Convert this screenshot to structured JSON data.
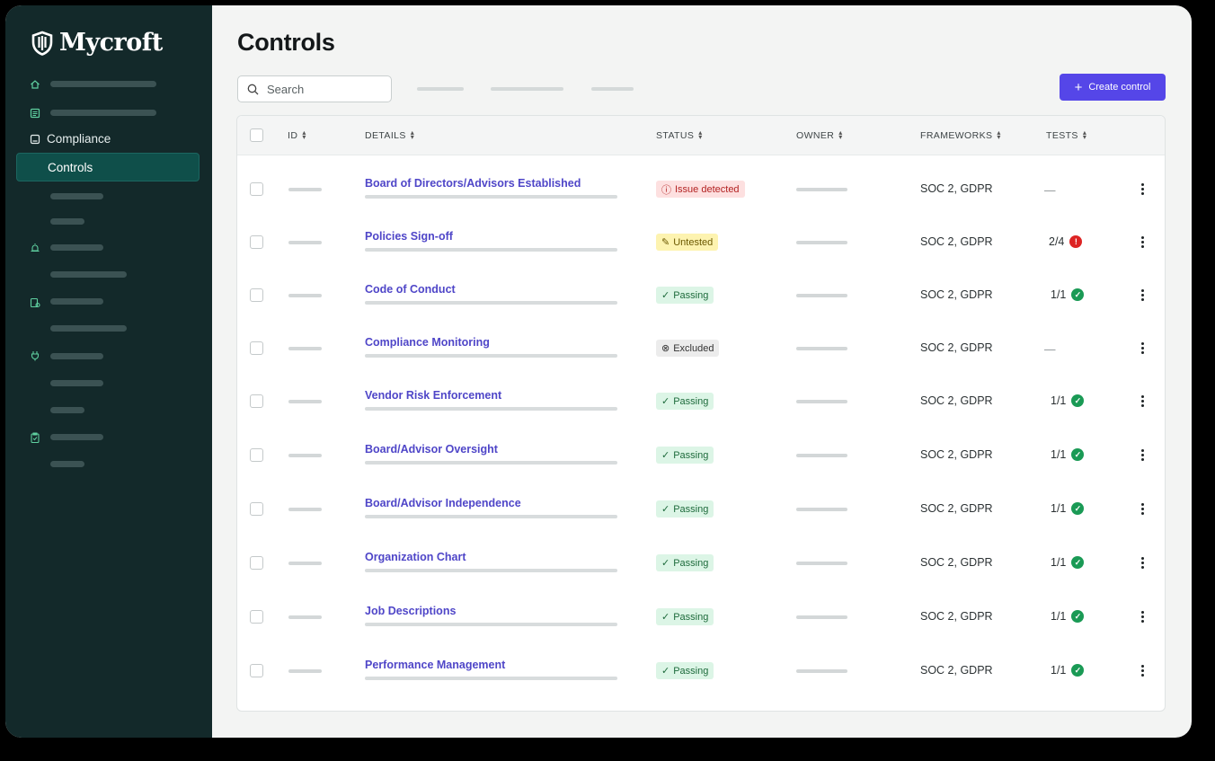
{
  "app": {
    "logo_text": "Mycroft"
  },
  "sidebar": {
    "compliance_label": "Compliance",
    "controls_label": "Controls"
  },
  "main": {
    "title": "Controls",
    "search_placeholder": "Search",
    "create_button_label": "Create control"
  },
  "table": {
    "headers": {
      "id": "ID",
      "details": "DETAILS",
      "status": "STATUS",
      "owner": "OWNER",
      "frameworks": "FRAMEWORKS",
      "tests": "TESTS"
    },
    "rows": [
      {
        "details": "Board of Directors/Advisors Established",
        "status": "Issue detected",
        "status_type": "issue",
        "frameworks": "SOC 2, GDPR",
        "tests": "—",
        "tests_state": "none"
      },
      {
        "details": "Policies Sign-off",
        "status": "Untested",
        "status_type": "untested",
        "frameworks": "SOC 2, GDPR",
        "tests": "2/4",
        "tests_state": "error"
      },
      {
        "details": "Code of Conduct",
        "status": "Passing",
        "status_type": "passing",
        "frameworks": "SOC 2, GDPR",
        "tests": "1/1",
        "tests_state": "ok"
      },
      {
        "details": "Compliance Monitoring",
        "status": "Excluded",
        "status_type": "excluded",
        "frameworks": "SOC 2, GDPR",
        "tests": "—",
        "tests_state": "none"
      },
      {
        "details": "Vendor Risk Enforcement",
        "status": "Passing",
        "status_type": "passing",
        "frameworks": "SOC 2, GDPR",
        "tests": "1/1",
        "tests_state": "ok"
      },
      {
        "details": "Board/Advisor Oversight",
        "status": "Passing",
        "status_type": "passing",
        "frameworks": "SOC 2, GDPR",
        "tests": "1/1",
        "tests_state": "ok"
      },
      {
        "details": "Board/Advisor Independence",
        "status": "Passing",
        "status_type": "passing",
        "frameworks": "SOC 2, GDPR",
        "tests": "1/1",
        "tests_state": "ok"
      },
      {
        "details": "Organization Chart",
        "status": "Passing",
        "status_type": "passing",
        "frameworks": "SOC 2, GDPR",
        "tests": "1/1",
        "tests_state": "ok"
      },
      {
        "details": "Job Descriptions",
        "status": "Passing",
        "status_type": "passing",
        "frameworks": "SOC 2, GDPR",
        "tests": "1/1",
        "tests_state": "ok"
      },
      {
        "details": "Performance Management",
        "status": "Passing",
        "status_type": "passing",
        "frameworks": "SOC 2, GDPR",
        "tests": "1/1",
        "tests_state": "ok"
      }
    ]
  },
  "colors": {
    "sidebar_bg": "#13292a",
    "accent": "#5546e8",
    "link": "#4f46c8",
    "passing": "#1a9a55",
    "issue": "#dd2424"
  }
}
